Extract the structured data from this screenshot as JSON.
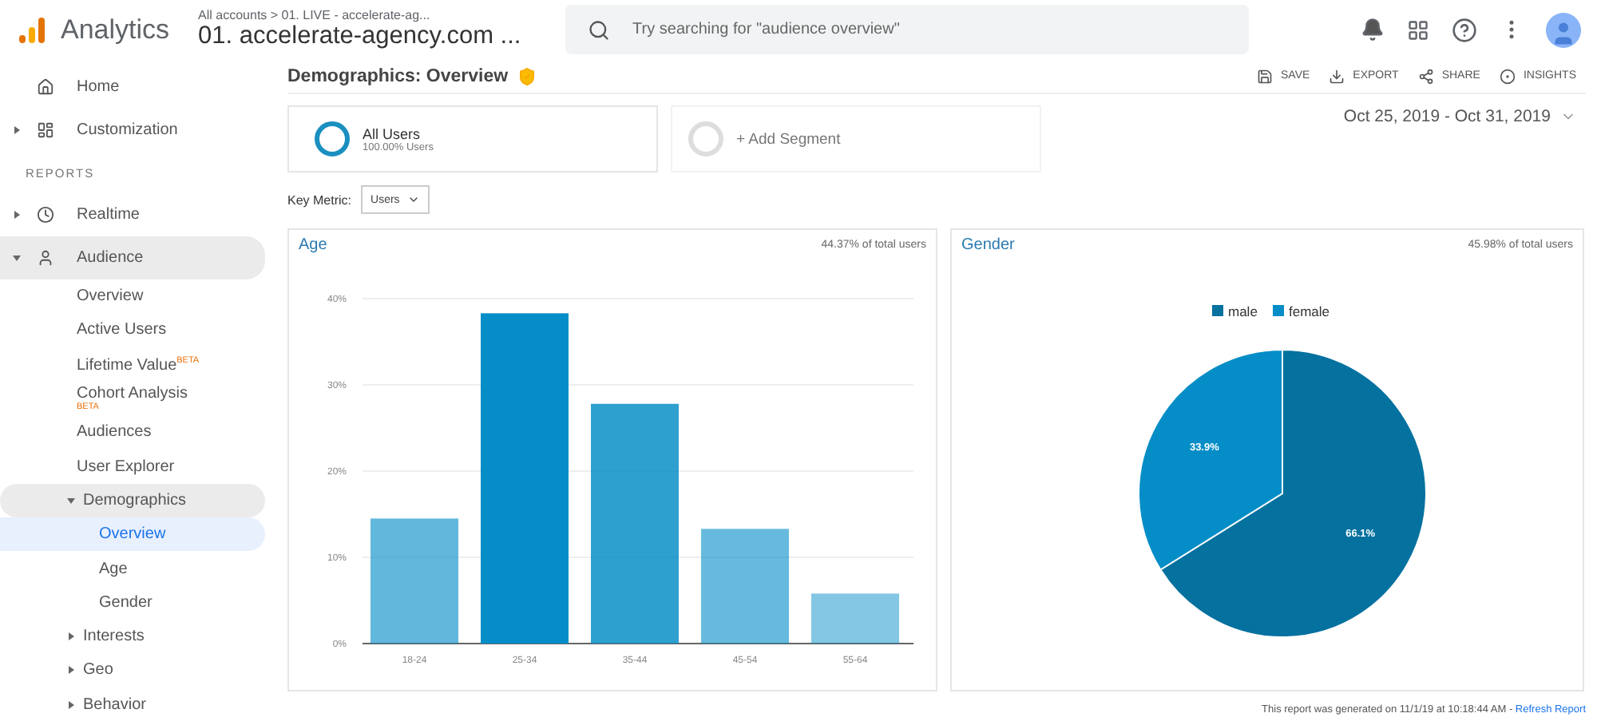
{
  "header": {
    "product": "Analytics",
    "breadcrumb": "All accounts > 01. LIVE - accelerate-ag...",
    "property": "01. accelerate-agency.com ...",
    "search": {
      "placeholder": "Try searching for \"audience overview\""
    }
  },
  "sidebar": {
    "items": [
      {
        "kind": "item",
        "label": "Home"
      },
      {
        "kind": "item",
        "label": "Customization",
        "expanded": false
      },
      {
        "kind": "heading",
        "label": "REPORTS"
      },
      {
        "kind": "item",
        "label": "Realtime",
        "expanded": false
      },
      {
        "kind": "item",
        "label": "Audience",
        "expanded": true,
        "children": [
          {
            "label": "Overview",
            "selected": false
          },
          {
            "label": "Active Users",
            "selected": false
          },
          {
            "label": "Lifetime Value",
            "badge": "BETA",
            "badge_wrapped": false,
            "selected": false
          },
          {
            "label": "Cohort Analysis",
            "badge": "BETA",
            "badge_wrapped": true,
            "selected": false
          },
          {
            "label": "Audiences",
            "selected": false
          },
          {
            "label": "User Explorer",
            "selected": false
          },
          {
            "label": "Demographics",
            "expanded": true,
            "selected": false,
            "children": [
              {
                "label": "Overview",
                "selected": true
              },
              {
                "label": "Age",
                "selected": false
              },
              {
                "label": "Gender",
                "selected": false
              }
            ]
          },
          {
            "label": "Interests",
            "expanded": false,
            "selected": false
          },
          {
            "label": "Geo",
            "expanded": false,
            "selected": false
          },
          {
            "label": "Behavior",
            "expanded": false,
            "selected": false
          }
        ]
      }
    ]
  },
  "report": {
    "title": "Demographics: Overview",
    "actions": [
      "SAVE",
      "EXPORT",
      "SHARE",
      "INSIGHTS"
    ],
    "segments": [
      {
        "name": "All Users",
        "detail": "100.00% Users"
      }
    ],
    "add_segment": "+ Add Segment",
    "date_range": "Oct 25, 2019 - Oct 31, 2019",
    "key_metric": {
      "label": "Key Metric:",
      "value": "Users"
    }
  },
  "cards": [
    {
      "title": "Age",
      "share": "44.37% of total users",
      "chart_data": {
        "type": "bar",
        "categories": [
          "18-24",
          "25-34",
          "35-44",
          "45-54",
          "55-64"
        ],
        "series": [
          {
            "color": "#058dc7",
            "values": [
              14.5,
              38.3,
              27.8,
              13.3,
              5.8
            ]
          }
        ],
        "grid": true,
        "ylim": [
          0,
          40
        ],
        "yticks": [
          {
            "value": 0,
            "label": "0%"
          },
          {
            "value": 10,
            "label": "10%"
          },
          {
            "value": 20,
            "label": "20%"
          },
          {
            "value": 30,
            "label": "30%"
          },
          {
            "value": 40,
            "label": "40%"
          }
        ]
      }
    },
    {
      "title": "Gender",
      "share": "45.98% of total users",
      "chart_data": {
        "type": "pie",
        "categories": [
          "male",
          "female"
        ],
        "series": [
          {
            "values": [
              66.1,
              33.9
            ]
          }
        ],
        "legend": "top",
        "value_labels": [
          "66.1%",
          "33.9%"
        ]
      }
    }
  ],
  "footer": {
    "text": "This report was generated on 11/1/19 at 10:18:44 AM - ",
    "link": "Refresh Report"
  }
}
